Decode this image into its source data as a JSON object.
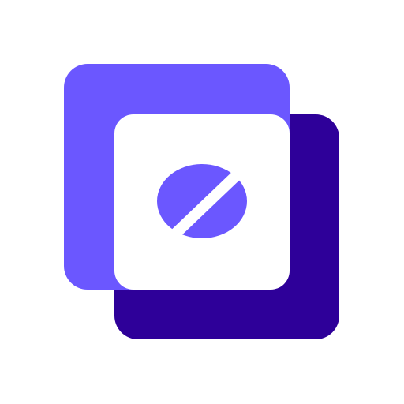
{
  "logo": {
    "icon": "coffee-bean-icon",
    "colors": {
      "background": "#ffffff",
      "back_square": "#2e0099",
      "front_square": "#6b57ff",
      "inner_card": "#ffffff",
      "bean": "#6b57ff",
      "bean_slash": "#ffffff"
    }
  }
}
